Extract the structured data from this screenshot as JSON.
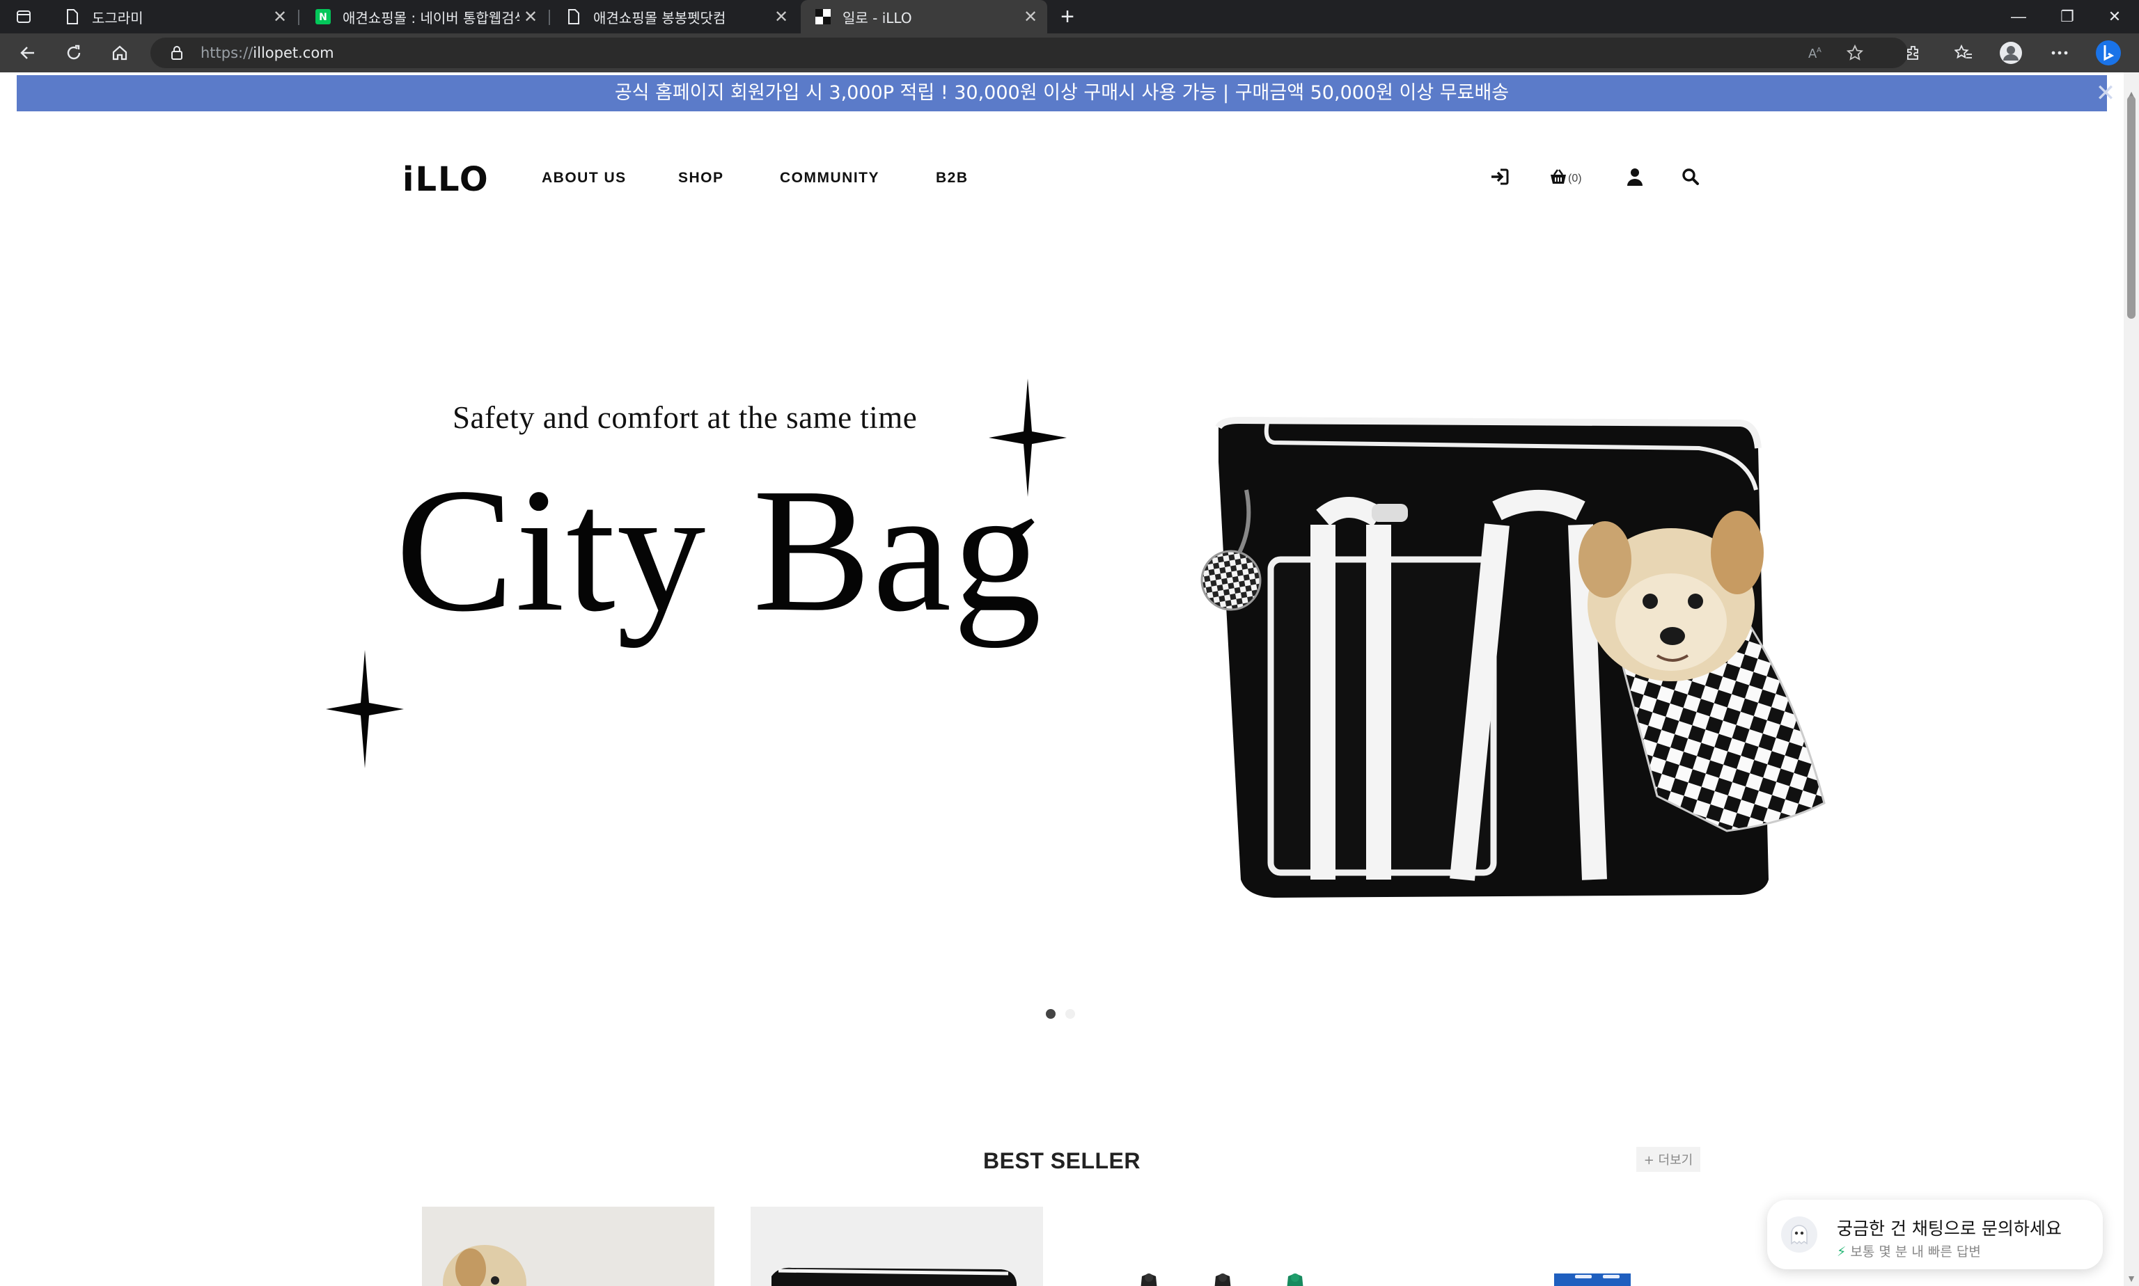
{
  "browser": {
    "tabs": [
      {
        "title": "도그라미",
        "active": false
      },
      {
        "title": "애견쇼핑몰 : 네이버 통합웹검색",
        "active": false
      },
      {
        "title": "애견쇼핑몰 봉봉펫닷컴",
        "active": false
      },
      {
        "title": "일로 - iLLO",
        "active": true
      }
    ],
    "tab_close_glyph": "✕",
    "new_tab_glyph": "+",
    "url_scheme": "https://",
    "url_host": "illopet.com",
    "window_controls": {
      "minimize": "—",
      "restore": "❐",
      "close": "✕"
    }
  },
  "page": {
    "promo_banner": "공식 홈페이지 회원가입 시 3,000P 적립 ! 30,000원 이상 구매시 사용 가능 | 구매금액 50,000원 이상 무료배송",
    "promo_close": "✕",
    "header": {
      "logo": "iLLO",
      "nav": [
        "ABOUT US",
        "SHOP",
        "COMMUNITY",
        "B2B"
      ],
      "cart_count": "(0)",
      "icons": [
        "login-icon",
        "cart-icon",
        "user-icon",
        "search-icon"
      ]
    },
    "hero": {
      "subtitle": "Safety and comfort at the same time",
      "title": "City Bag",
      "slide_count": 2,
      "active_slide": 0
    },
    "best_seller": {
      "title": "BEST SELLER",
      "more_label": "+ 더보기"
    },
    "chat_widget": {
      "title": "궁금한 건 채팅으로 문의하세요",
      "subtitle": "보통 몇 분 내 빠른 답변",
      "bolt": "⚡"
    },
    "colors": {
      "promo_bg": "#5b7bc9",
      "chat_accent": "#22b573"
    }
  }
}
